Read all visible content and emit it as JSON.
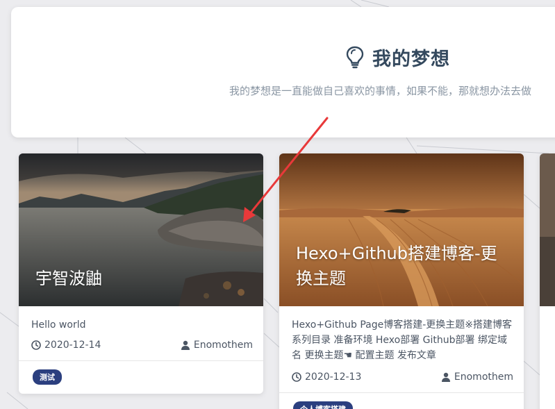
{
  "dream": {
    "title": "我的梦想",
    "subtitle": "我的梦想是一直能做自己喜欢的事情，如果不能，那就想办法去做"
  },
  "posts": [
    {
      "cover_title": "宇智波鼬",
      "summary": "Hello world",
      "date": "2020-12-14",
      "author": "Enomothem",
      "tag": "测试"
    },
    {
      "cover_title": "Hexo+Github搭建博客-更换主题",
      "summary": "Hexo+Github Page博客搭建-更换主题※搭建博客系列目录 准备环境 Hexo部署 Github部署 绑定域名 更换主题☚ 配置主题 发布文章 Picgo+Typora...",
      "date": "2020-12-13",
      "author": "Enomothem",
      "tag": "个人博客搭建"
    }
  ],
  "icons": {
    "bulb": "lightbulb-icon",
    "clock": "clock-icon",
    "user": "user-icon"
  },
  "colors": {
    "title": "#34495e",
    "tag_bg": "#2b3f7f",
    "arrow": "#e8393a"
  }
}
